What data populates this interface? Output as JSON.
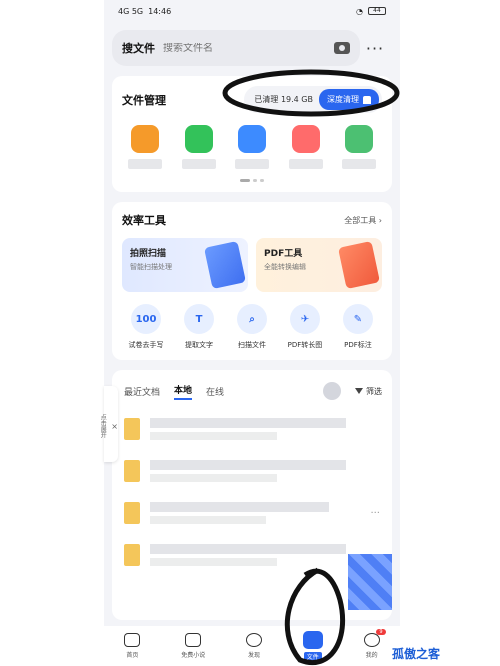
{
  "status": {
    "left": "4G 5G",
    "time": "14:46",
    "battery": "44"
  },
  "search": {
    "title": "搜文件",
    "placeholder": "搜索文件名"
  },
  "file_manager": {
    "title": "文件管理",
    "clean_text": "已清理 19.4 GB",
    "clean_button": "深度清理",
    "apps": [
      {
        "icon": "download-app-icon",
        "color": "#f59a2a"
      },
      {
        "icon": "wechat-app-icon",
        "color": "#33c25a"
      },
      {
        "icon": "image-app-icon",
        "color": "#3d8bff"
      },
      {
        "icon": "video-app-icon",
        "color": "#ff6b6b"
      },
      {
        "icon": "other-app-icon",
        "color": "#4cc072"
      }
    ]
  },
  "tools": {
    "title": "效率工具",
    "all_label": "全部工具",
    "scan_title": "拍照扫描",
    "scan_sub": "智能扫描处理",
    "pdf_title": "PDF工具",
    "pdf_sub": "全能转换编辑",
    "items": [
      {
        "label": "试卷去手写",
        "glyph": "100"
      },
      {
        "label": "提取文字",
        "glyph": "T"
      },
      {
        "label": "扫描文件",
        "glyph": "⌕"
      },
      {
        "label": "PDF转长图",
        "glyph": "✈"
      },
      {
        "label": "PDF标注",
        "glyph": "✎"
      }
    ]
  },
  "files": {
    "tabs": [
      "最近文档",
      "本地",
      "在线"
    ],
    "active_tab": "本地",
    "filter_label": "筛选"
  },
  "side_panel": {
    "label": "点击展开"
  },
  "tabbar": {
    "items": [
      "首页",
      "免费小说",
      "发现",
      "文件",
      "我的"
    ],
    "active": "文件",
    "badge": "9"
  },
  "watermark": "孤傲之客",
  "accent": "#2a66ef"
}
